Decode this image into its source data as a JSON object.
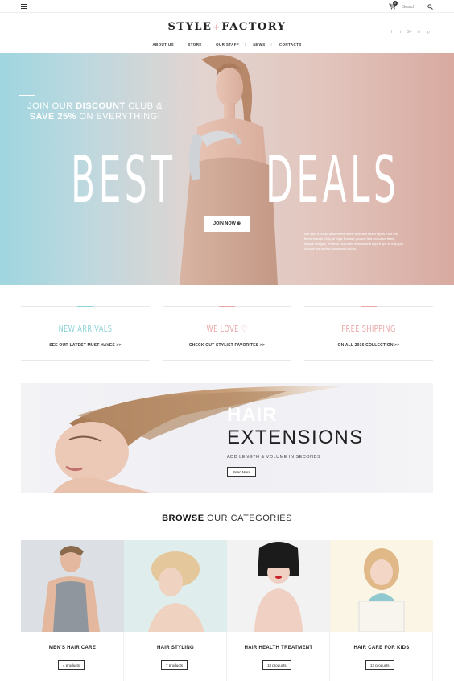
{
  "topbar": {
    "search_placeholder": "Search",
    "cart_count": "0"
  },
  "header": {
    "logo_left": "STYLE",
    "logo_sep": "+",
    "logo_right": "FACTORY",
    "social": [
      "f",
      "t",
      "G+",
      "in",
      "p"
    ]
  },
  "nav": {
    "items": [
      "ABOUT US",
      "STORE",
      "OUR STAFF",
      "NEWS",
      "CONTACTS"
    ]
  },
  "hero": {
    "promo_line1_pre": "JOIN OUR ",
    "promo_line1_bold": "DISCOUNT",
    "promo_line1_post": " CLUB &",
    "promo_line2_bold": "SAVE 25%",
    "promo_line2_post": " ON EVERYTHING!",
    "title_left": "BEST",
    "title_right": "DEALS",
    "description": "We offer a broad assortment of the best and latest styles from the finest brands. Only at Style Factory you will find exclusive items, unique designs, endless customer reviews and expert tips to help you choose the perfect styles and colors.",
    "button_label": "JOIN NOW"
  },
  "features": [
    {
      "title": "NEW ARRIVALS",
      "link": "SEE OUR LATEST MUST-HAVES  >>",
      "color": "#8fd3d8"
    },
    {
      "title": "WE LOVE",
      "link": "CHECK OUT STYLIST FAVORITES >>",
      "color": "#e8a8a8"
    },
    {
      "title": "FREE SHIPPING",
      "link": "ON ALL 2016 COLLECTION >>",
      "color": "#e8a8a8"
    }
  ],
  "banner": {
    "title_line1": "HAIR",
    "title_line2": "EXTENSIONS",
    "subtitle": "ADD LENGTH & VOLUME IN SECONDS",
    "button_label": "Read More"
  },
  "categories": {
    "heading_bold": "BROWSE",
    "heading_rest": " OUR CATEGORIES",
    "items": [
      {
        "name": "MEN'S HAIR CARE",
        "count": "4 products"
      },
      {
        "name": "HAIR STYLING",
        "count": "7 products"
      },
      {
        "name": "HAIR HEALTH TREATMENT",
        "count": "18 products"
      },
      {
        "name": "HAIR CARE FOR KIDS",
        "count": "13 products"
      }
    ]
  },
  "colors": {
    "accent_teal": "#8fd3d8",
    "accent_pink": "#e8a8a8"
  }
}
